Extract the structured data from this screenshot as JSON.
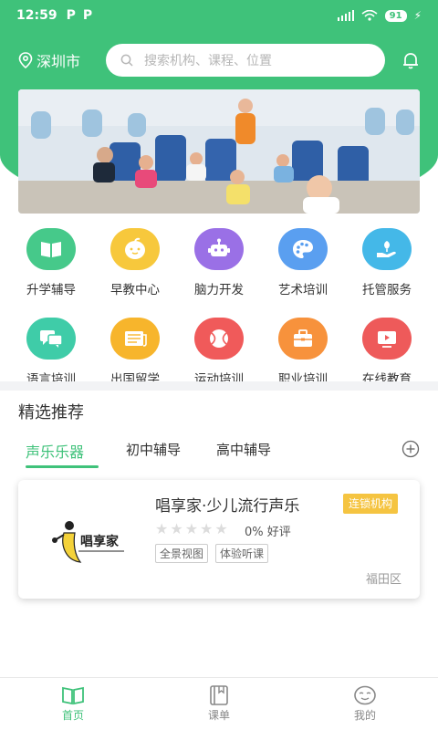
{
  "status_bar": {
    "time": "12:59",
    "badges": [
      "P",
      "P"
    ],
    "battery": "91"
  },
  "header": {
    "city": "深圳市",
    "search_placeholder": "搜索机构、课程、位置",
    "accent_color": "#3fc27a"
  },
  "categories_row1": [
    {
      "label": "升学辅导",
      "icon": "book-icon",
      "color": "#46c98a"
    },
    {
      "label": "早教中心",
      "icon": "lemon-face-icon",
      "color": "#f7c83c"
    },
    {
      "label": "脑力开发",
      "icon": "robot-icon",
      "color": "#9a70e6"
    },
    {
      "label": "艺术培训",
      "icon": "palette-icon",
      "color": "#5a9ff0"
    },
    {
      "label": "托管服务",
      "icon": "hand-leaf-icon",
      "color": "#44b8e8"
    }
  ],
  "categories_row2": [
    {
      "label": "语言培训",
      "icon": "chat-icon",
      "color": "#3fcca8"
    },
    {
      "label": "出国留学",
      "icon": "newspaper-icon",
      "color": "#f7b52c"
    },
    {
      "label": "运动培训",
      "icon": "ball-icon",
      "color": "#f05a5a"
    },
    {
      "label": "职业培训",
      "icon": "briefcase-icon",
      "color": "#f7923c"
    },
    {
      "label": "在线教育",
      "icon": "play-screen-icon",
      "color": "#ee5a5a"
    }
  ],
  "recommend": {
    "title": "精选推荐",
    "tabs": [
      "声乐乐器",
      "初中辅导",
      "高中辅导"
    ],
    "active_tab": 0
  },
  "card": {
    "name": "唱享家·少儿流行声乐",
    "badge": "连锁机构",
    "logo_text": "唱享家",
    "stars": 0,
    "rating": "0% 好评",
    "tags": [
      "全景视图",
      "体验听课"
    ],
    "district": "福田区"
  },
  "bottom_nav": [
    {
      "label": "首页",
      "icon": "home-book-icon",
      "active": true
    },
    {
      "label": "课单",
      "icon": "notebook-icon",
      "active": false
    },
    {
      "label": "我的",
      "icon": "smiley-icon",
      "active": false
    }
  ]
}
